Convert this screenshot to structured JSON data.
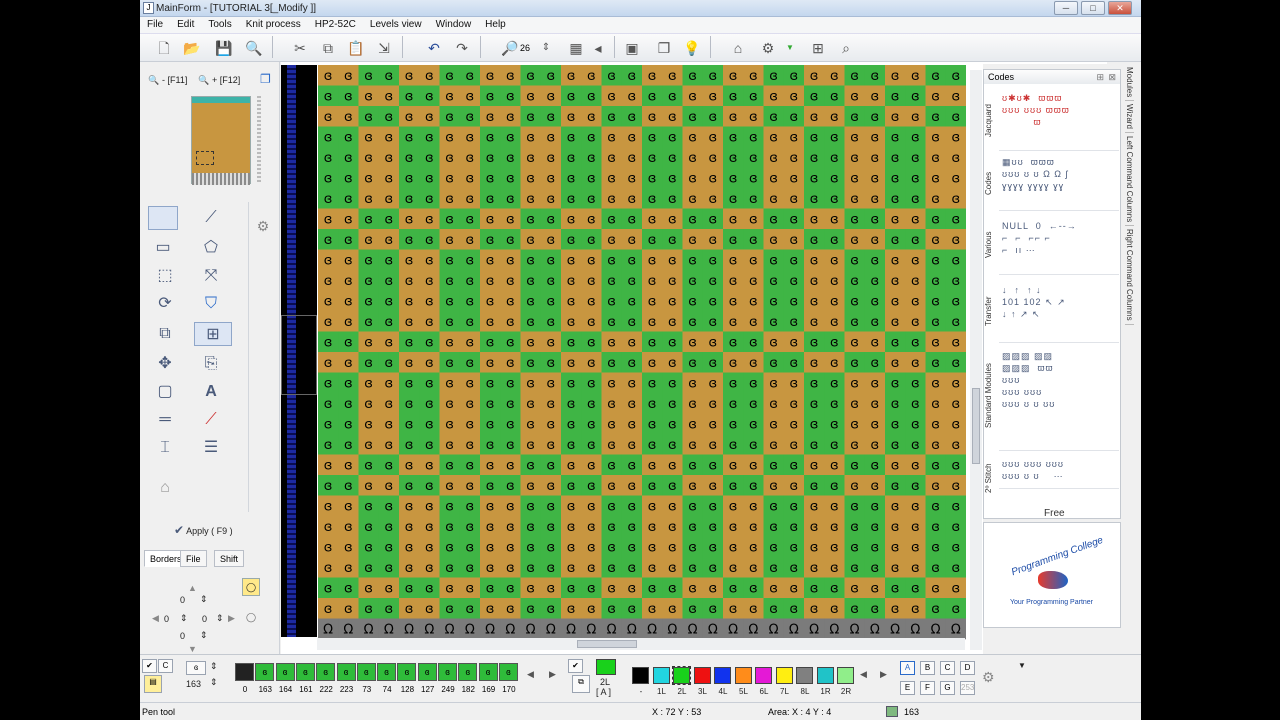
{
  "window": {
    "title": "MainForm - [TUTORIAL 3[_Modify ]]"
  },
  "menu": [
    "File",
    "Edit",
    "Tools",
    "Knit process",
    "HP2-52C",
    "Levels view",
    "Window",
    "Help"
  ],
  "toolbar": {
    "zoom_value": "26"
  },
  "left_panel": {
    "zoom_out_label": "- [F11]",
    "zoom_in_label": "+ [F12]",
    "apply_label": "Apply ( F9 )",
    "tabs": [
      "Borders",
      "File",
      "Shift"
    ],
    "shift_values": [
      "0",
      "0",
      "0",
      "0"
    ]
  },
  "canvas": {
    "colors": {
      "green": "#3fb545",
      "brown": "#c89640",
      "stitch": "#000000"
    },
    "stitch_glyph": "ɞ",
    "bottom_glyph": "Ω"
  },
  "right_panel": {
    "header": "Codes",
    "sections": [
      "Jacquard",
      "Codes",
      "Various",
      "Transfer",
      "Standard Modules",
      "2º Stitch"
    ],
    "various_null": "NULL",
    "various_zero": "0",
    "transfer_labels": [
      "101",
      "102"
    ],
    "free_label": "Free",
    "side_tabs": [
      "Modules",
      "Wizard",
      "Left Command Columns",
      "Right Command Columns"
    ],
    "logo_title": "Programming College",
    "logo_subtitle": "Your Programming Partner"
  },
  "bottom": {
    "yarn_counter": "163",
    "stitch_codes": [
      "0",
      "163",
      "164",
      "161",
      "222",
      "223",
      "73",
      "74",
      "128",
      "127",
      "249",
      "182",
      "169",
      "170"
    ],
    "selected_label": "2L",
    "selected_sub": "[ A ]",
    "color_labels": [
      "-",
      "1L",
      "2L",
      "3L",
      "4L",
      "5L",
      "6L",
      "7L",
      "8L",
      "1R",
      "2R"
    ],
    "colors": [
      "#000000",
      "#22d5e0",
      "#19d11b",
      "#ee1111",
      "#1133ee",
      "#ff8c1a",
      "#e419d6",
      "#ffee11",
      "#808080",
      "#20c3c8",
      "#90ee8a"
    ],
    "letters_top": [
      "A",
      "B",
      "C",
      "D"
    ],
    "letters_bottom": [
      "E",
      "F",
      "G",
      "253"
    ]
  },
  "status": {
    "tool": "Pen tool",
    "coords": "X : 72   Y : 53",
    "area": "Area: X : 4   Y : 4",
    "code": "163"
  }
}
